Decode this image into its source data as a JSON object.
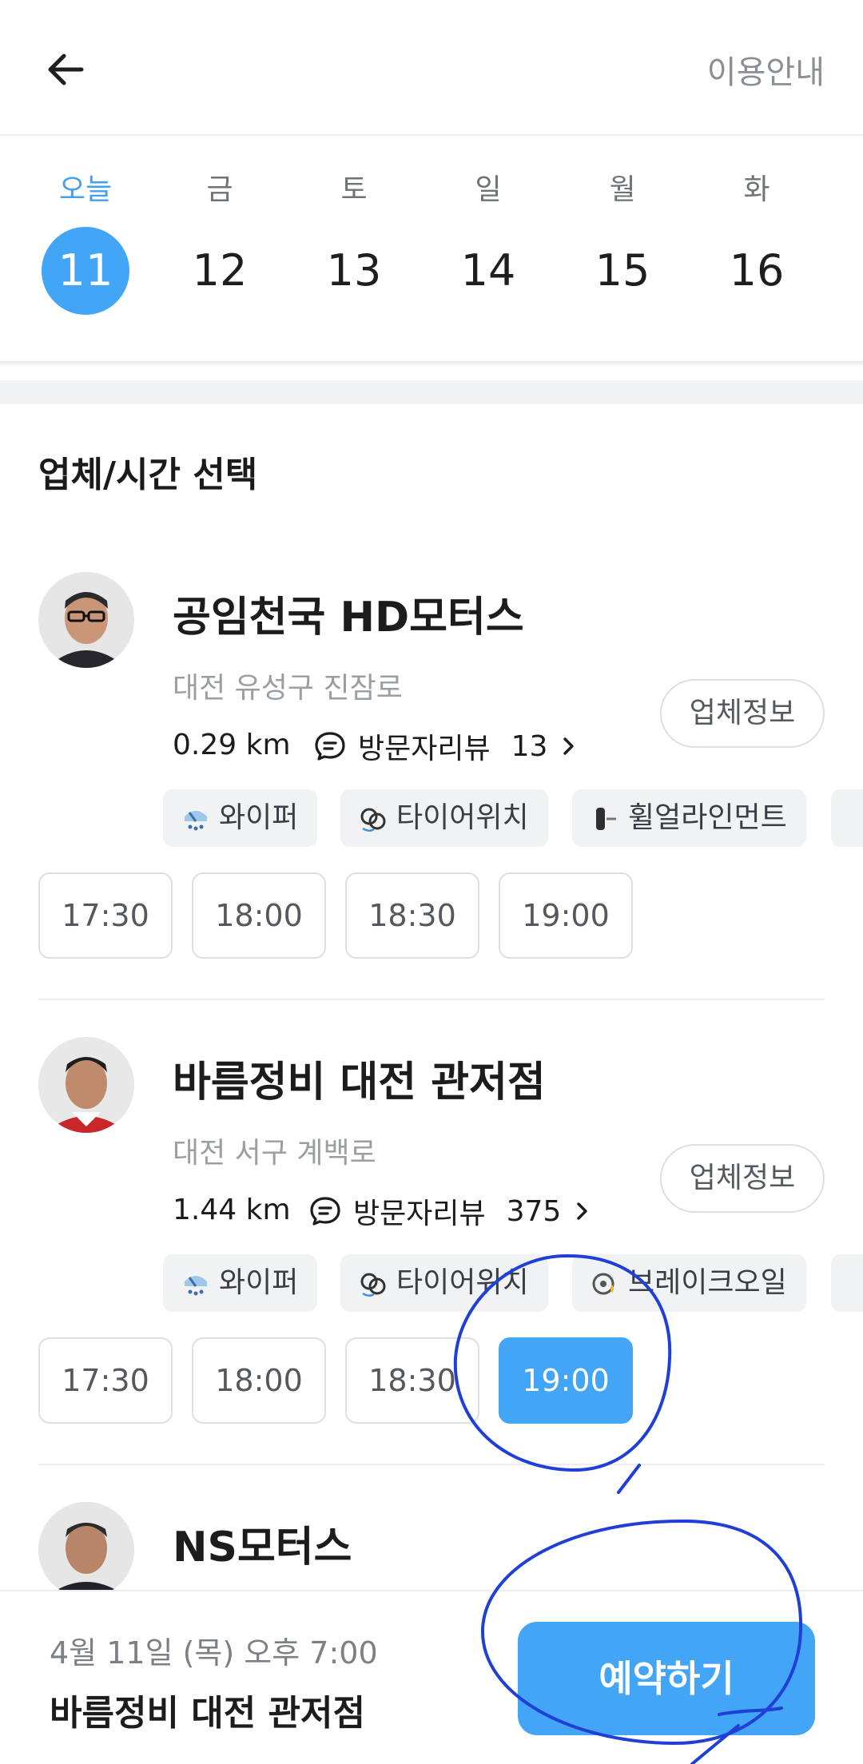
{
  "header": {
    "back_icon": "arrow-left-icon",
    "guide_label": "이용안내"
  },
  "dates": [
    {
      "dow": "오늘",
      "day": "11",
      "selected": true
    },
    {
      "dow": "금",
      "day": "12"
    },
    {
      "dow": "토",
      "day": "13"
    },
    {
      "dow": "일",
      "day": "14"
    },
    {
      "dow": "월",
      "day": "15"
    },
    {
      "dow": "화",
      "day": "16"
    }
  ],
  "section_title": "업체/시간 선택",
  "shops": [
    {
      "name": "공임천국 HD모터스",
      "address": "대전 유성구 진잠로",
      "distance": "0.29 km",
      "review_label": "방문자리뷰",
      "review_count": "13",
      "info_label": "업체정보",
      "tags": [
        {
          "label": "와이퍼",
          "icon": "wiper-icon"
        },
        {
          "label": "타이어위치",
          "icon": "tire-rotation-icon"
        },
        {
          "label": "휠얼라인먼트",
          "icon": "wheel-alignment-icon"
        }
      ],
      "slots": [
        {
          "time": "17:30"
        },
        {
          "time": "18:00"
        },
        {
          "time": "18:30"
        },
        {
          "time": "19:00"
        }
      ]
    },
    {
      "name": "바름정비 대전 관저점",
      "address": "대전 서구 계백로",
      "distance": "1.44 km",
      "review_label": "방문자리뷰",
      "review_count": "375",
      "info_label": "업체정보",
      "tags": [
        {
          "label": "와이퍼",
          "icon": "wiper-icon"
        },
        {
          "label": "타이어위치",
          "icon": "tire-rotation-icon"
        },
        {
          "label": "브레이크오일",
          "icon": "brake-oil-icon"
        }
      ],
      "slots": [
        {
          "time": "17:30"
        },
        {
          "time": "18:00"
        },
        {
          "time": "18:30"
        },
        {
          "time": "19:00",
          "selected": true
        }
      ]
    },
    {
      "name": "NS모터스"
    }
  ],
  "bottom_bar": {
    "datetime": "4월 11일 (목) 오후 7:00",
    "shop_name": "바름정비 대전 관저점",
    "reserve_label": "예약하기"
  },
  "colors": {
    "accent": "#42a5f5",
    "annotation": "#1f3fd6"
  }
}
